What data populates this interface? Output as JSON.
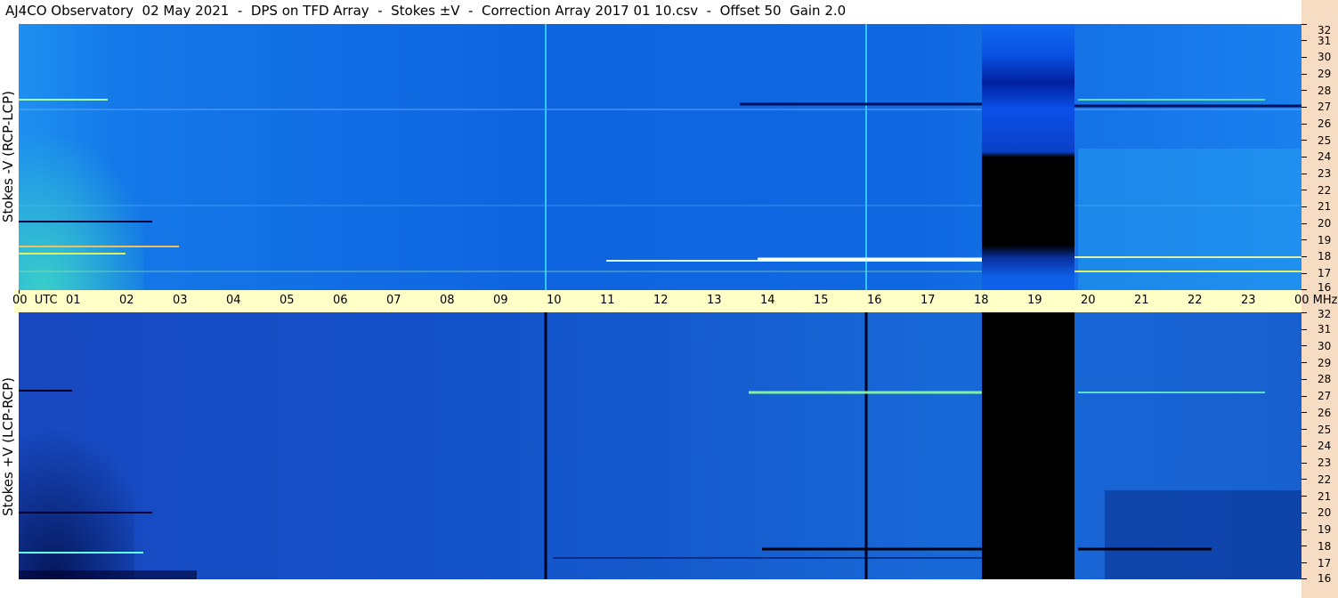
{
  "title": "AJ4CO Observatory  02 May 2021  -  DPS on TFD Array  -  Stokes ±V  -  Correction Array 2017 01 10.csv  -  Offset 50  Gain 2.0",
  "panels": {
    "top": {
      "label": "Stokes -V (RCP-LCP)"
    },
    "bottom": {
      "label": "Stokes +V (LCP-RCP)"
    }
  },
  "time_axis": {
    "labels": [
      "00  UTC",
      "01",
      "02",
      "03",
      "04",
      "05",
      "06",
      "07",
      "08",
      "09",
      "10",
      "11",
      "12",
      "13",
      "14",
      "15",
      "16",
      "17",
      "18",
      "19",
      "20",
      "21",
      "22",
      "23",
      "00 MHz"
    ]
  },
  "freq_axis": {
    "labels": [
      "32",
      "31",
      "30",
      "29",
      "28",
      "27",
      "26",
      "25",
      "24",
      "23",
      "22",
      "21",
      "20",
      "19",
      "18",
      "17",
      "16"
    ]
  },
  "colors": {
    "top_background": "#0f64e0",
    "bottom_background": "#1450c8",
    "data_gap": "#000000",
    "time_axis_bg": "#ffffc8",
    "freq_axis_bg": "#f7dcc4"
  }
}
